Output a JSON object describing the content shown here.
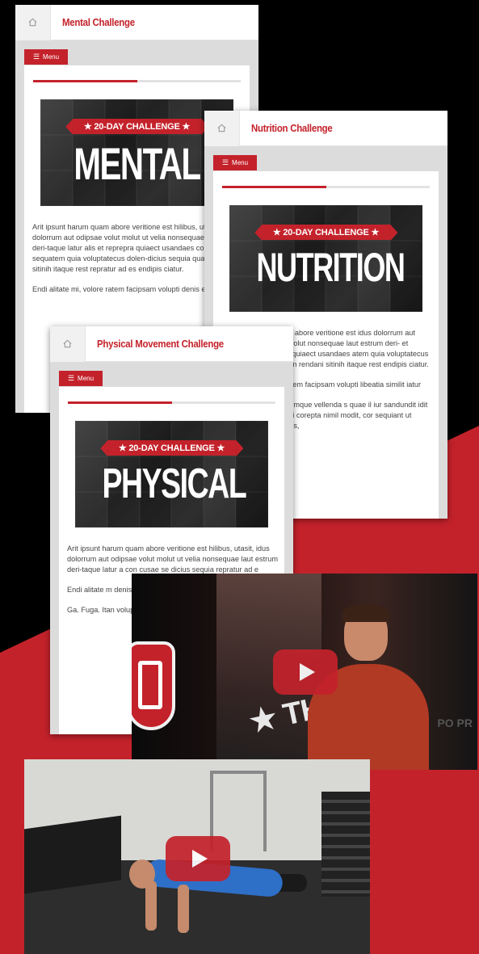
{
  "colors": {
    "brand_red": "#c4222b",
    "background": "#000000"
  },
  "common": {
    "menu_label": "Menu",
    "menu_icon": "hamburger-icon",
    "home_icon": "home-icon",
    "banner_text": "★ 20-DAY CHALLENGE ★"
  },
  "mental": {
    "title": "Mental Challenge",
    "hero_word": "MENTAL",
    "progress": 0.5,
    "paragraphs": [
      "Arit ipsunt harum quam abore veritione est hilibus, utasit, idus dolorrum aut odipsae volut molut ut velia nonsequae laut estrum deri-taque latur alis et reprepra quiaect usandaes con cusae sequatem quia voluptatecus dolen-dicius sequia quam rendani sitinih itaque rest repratur ad es endipis ciatur.",
      "Endi alitate mi, volore ratem facipsam volupti denis exceaqu"
    ]
  },
  "nutrition": {
    "title": "Nutrition Challenge",
    "hero_word": "NUTRITION",
    "progress": 0.5,
    "paragraphs": [
      "um quam abore veritione est idus dolorrum aut odipsae volut nonsequae laut estrum deri- et reprepra quiaect usandaes atem quia voluptatecus dolen-uam rendani sitinih itaque rest endipis ciatur.",
      "volore ratem facipsam volupti libeatia similit iatur",
      "ut alist, temque vellenda s quae il iur sandundit idit lab re, qui corepta nimil modit, cor sequiant ut assus, nus,"
    ]
  },
  "physical": {
    "title": "Physical Movement Challenge",
    "hero_word": "PHYSICAL",
    "progress": 0.5,
    "paragraphs": [
      "Arit ipsunt harum quam abore veritione est hilibus, utasit, idus dolorrum aut odipsae volut molut ut velia nonsequae laut estrum deri-taque latur a con cusae se dicius sequia repratur ad e",
      "Endi alitate m denis exceaq",
      "Ga. Fuga. Itan voluptatum r ipsam ium ab nobitae non"
    ]
  },
  "videos": {
    "v1": {
      "play_icon": "play-icon",
      "bg_text": "★ THE",
      "side_text": "PO PR"
    },
    "v2": {
      "play_icon": "play-icon"
    }
  }
}
